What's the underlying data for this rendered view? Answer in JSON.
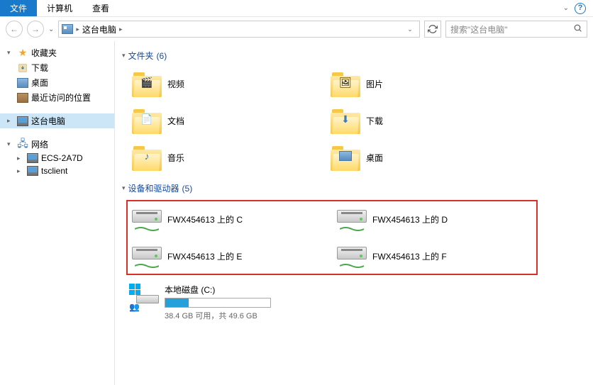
{
  "ribbon": {
    "file": "文件",
    "computer": "计算机",
    "view": "查看"
  },
  "breadcrumb": {
    "location": "这台电脑"
  },
  "search": {
    "placeholder": "搜索\"这台电脑\""
  },
  "sidebar": {
    "favorites": "收藏夹",
    "downloads": "下载",
    "desktop": "桌面",
    "recent": "最近访问的位置",
    "thispc": "这台电脑",
    "network": "网络",
    "netnode1": "ECS-2A7D",
    "netnode2": "tsclient"
  },
  "groups": {
    "folders_label": "文件夹",
    "folders_count": "(6)",
    "devices_label": "设备和驱动器",
    "devices_count": "(5)"
  },
  "folders": {
    "video": "视频",
    "pictures": "图片",
    "documents": "文档",
    "downloads": "下载",
    "music": "音乐",
    "desktop": "桌面"
  },
  "drives": {
    "c": "FWX454613 上的 C",
    "d": "FWX454613 上的 D",
    "e": "FWX454613 上的 E",
    "f": "FWX454613 上的 F"
  },
  "localdisk": {
    "name": "本地磁盘 (C:)",
    "sub": "38.4 GB 可用，共 49.6 GB"
  }
}
